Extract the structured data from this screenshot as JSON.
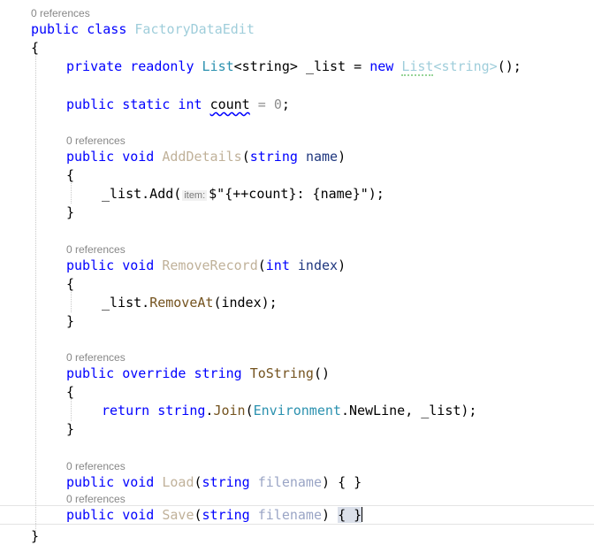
{
  "references_label": "0 references",
  "class_decl": {
    "kw_public": "public",
    "kw_class": "class",
    "name": "FactoryDataEdit"
  },
  "field_list": {
    "modifiers": "private readonly",
    "type": "List",
    "generic": "<string>",
    "name": "_list",
    "kw_new": "new",
    "new_type": "List",
    "new_generic": "<string>",
    "tail": "();"
  },
  "field_count": {
    "modifiers": "public static int",
    "name": "count",
    "init": "0"
  },
  "method_add": {
    "signature_kw": "public void",
    "name": "AddDetails",
    "param_type": "string",
    "param_name": "name",
    "body_call": "_list.Add(",
    "hint": "item:",
    "body_str": "$\"{++count}: {name}\"",
    "body_end": ");"
  },
  "method_remove": {
    "signature_kw": "public void",
    "name": "RemoveRecord",
    "param_type": "int",
    "param_name": "index",
    "body_obj": "_list.",
    "body_fn": "RemoveAt",
    "body_args": "(index);"
  },
  "method_tostring": {
    "signature_kw": "public override string",
    "name": "ToString",
    "body_kw": "return",
    "body_type": "string",
    "body_fn": "Join",
    "body_env": "Environment",
    "body_prop": "NewLine",
    "body_arg2": "_list",
    "body_end": ");"
  },
  "method_load": {
    "signature_kw": "public void",
    "name": "Load",
    "param_type": "string",
    "param_name": "filename",
    "body": "{ }"
  },
  "method_save": {
    "signature_kw": "public void",
    "name": "Save",
    "param_type": "string",
    "param_name": "filename",
    "body_open": "{ ",
    "body_close": "}"
  },
  "brace_open": "{",
  "brace_close": "}",
  "empty_parens": "()",
  "paren_open": "(",
  "paren_close": ")",
  "comma": ",",
  "equals": "=",
  "semicolon": ";",
  "dot": "."
}
